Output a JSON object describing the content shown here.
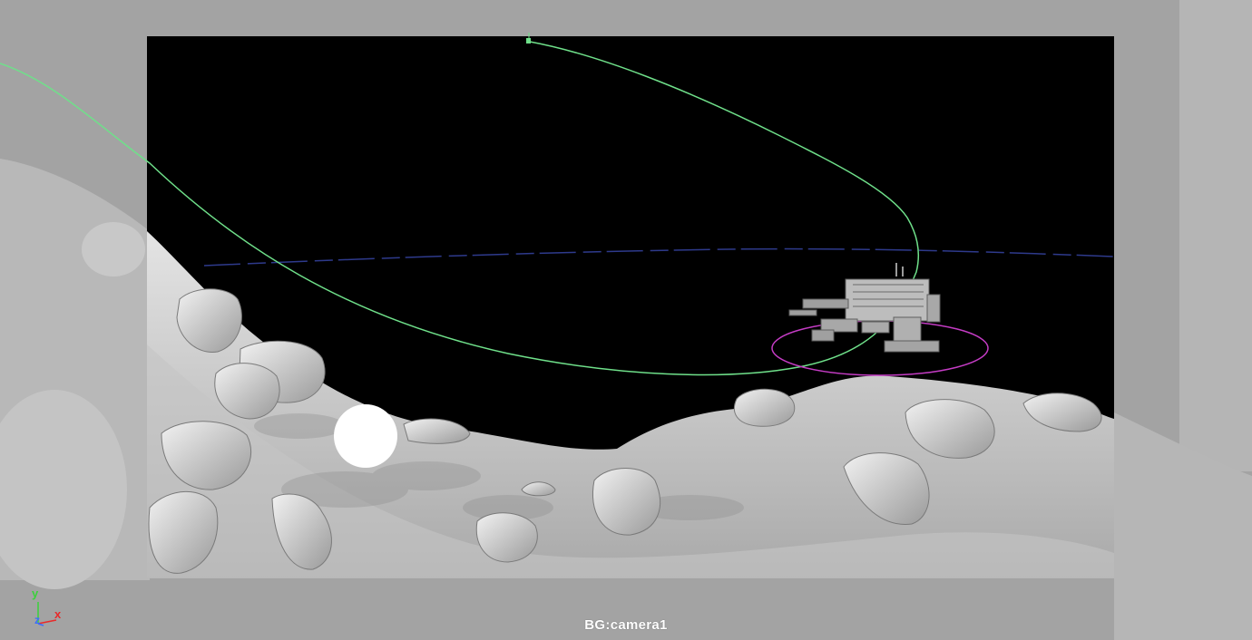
{
  "viewport": {
    "camera_name": "BG:camera1",
    "axis_labels": {
      "x": "x",
      "y": "y",
      "z": "z"
    }
  },
  "colors": {
    "background": "#9a9a9a",
    "gate_black": "#000000",
    "terrain": "#cfcfcf",
    "curve": "#6fe08a",
    "selection_circle": "#c53cc5",
    "horizon": "#2e3a8c",
    "axis_x": "#e82a2a",
    "axis_y": "#3ad13a",
    "axis_z": "#3a6dff"
  },
  "icons": [
    "axis-gizmo-icon",
    "locator-icon",
    "sphere-icon"
  ]
}
